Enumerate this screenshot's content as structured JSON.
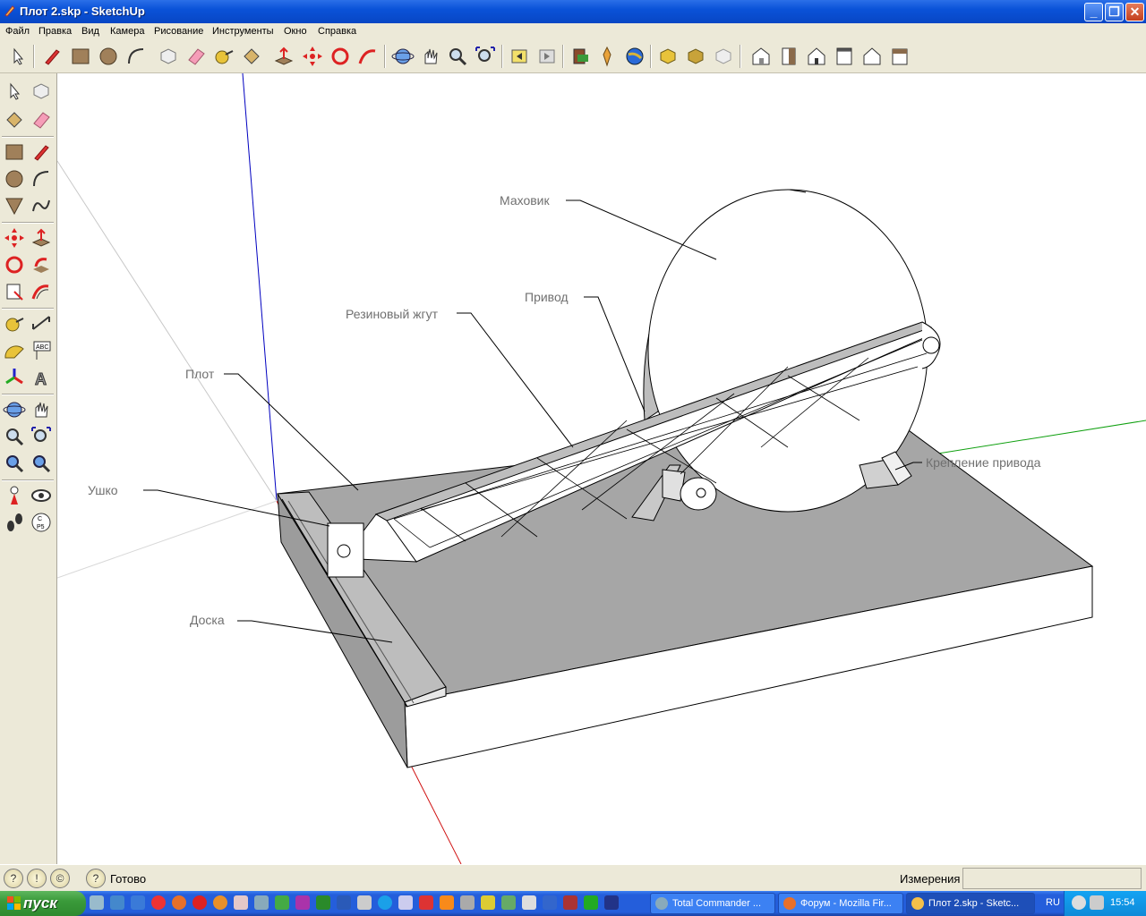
{
  "window": {
    "title": "Плот 2.skp - SketchUp"
  },
  "menu": [
    "Файл",
    "Правка",
    "Вид",
    "Камера",
    "Рисование",
    "Инструменты",
    "Окно",
    "Справка"
  ],
  "toolbar_icons": [
    "select-icon",
    "pencil-icon",
    "rectangle-icon",
    "circle-icon",
    "arc-icon",
    "make-component-icon",
    "eraser-icon",
    "tape-measure-icon",
    "paint-bucket-icon",
    "push-pull-icon",
    "move-icon",
    "rotate-icon",
    "follow-me-icon",
    "orbit-icon",
    "pan-icon",
    "zoom-icon",
    "zoom-extents-icon",
    "previous-view-icon",
    "next-view-icon",
    "get-models-icon",
    "share-model-icon",
    "google-earth-icon",
    "export-icon",
    "import-icon",
    "component-icon",
    "iso-view-icon",
    "top-view-icon",
    "front-view-icon",
    "right-view-icon",
    "back-view-icon",
    "left-view-icon"
  ],
  "scene": {
    "labels": {
      "flywheel": "Маховик",
      "drive": "Привод",
      "rubber": "Резиновый жгут",
      "raft": "Плот",
      "eye": "Ушко",
      "board": "Доска",
      "mount": "Крепление привода"
    }
  },
  "status": {
    "text": "Готово",
    "measurements_label": "Измерения",
    "measurements_value": ""
  },
  "taskbar": {
    "start": "пуск",
    "tasks": [
      "Total Commander ...",
      "Форум - Mozilla Fir...",
      "Плот 2.skp - Sketc..."
    ],
    "lang": "RU",
    "clock": "15:54"
  },
  "colors": {
    "titlebar": "#0a52d8",
    "taskbar": "#245edb",
    "start": "#3a9a3a",
    "model_face": "#a6a6a6"
  }
}
